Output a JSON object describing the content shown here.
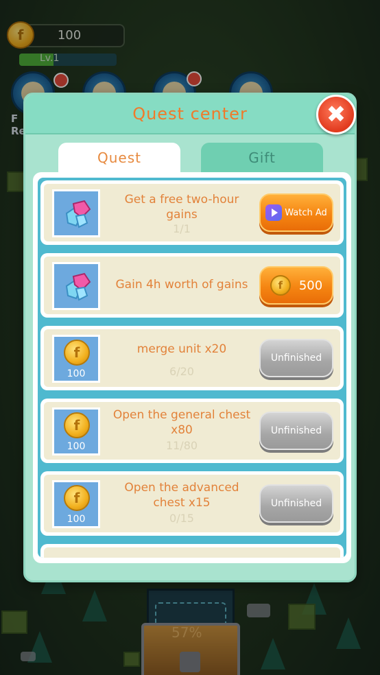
{
  "hud": {
    "coins": "100",
    "coin_symbol": "f",
    "level": "Lv.1",
    "level_progress": 0.35,
    "side_label_1": "F",
    "side_label_2": "Re"
  },
  "modal": {
    "title": "Quest center",
    "close_label": "✖",
    "tabs": [
      {
        "label": "Quest",
        "active": true
      },
      {
        "label": "Gift",
        "active": false
      }
    ]
  },
  "quests": [
    {
      "title": "Get a free two-hour gains",
      "progress": "1/1",
      "reward_icon": "gem-icon",
      "reward_amount": "",
      "button": {
        "type": "ad",
        "label": "Watch Ad"
      }
    },
    {
      "title": "Gain 4h worth of gains",
      "progress": "",
      "reward_icon": "gem-icon",
      "reward_amount": "",
      "button": {
        "type": "buy",
        "label": "500"
      }
    },
    {
      "title": "merge unit x20",
      "progress": "6/20",
      "reward_icon": "coin-icon",
      "reward_amount": "100",
      "button": {
        "type": "unfinished",
        "label": "Unfinished"
      }
    },
    {
      "title": "Open the general chest x80",
      "progress": "11/80",
      "reward_icon": "coin-icon",
      "reward_amount": "100",
      "button": {
        "type": "unfinished",
        "label": "Unfinished"
      }
    },
    {
      "title": "Open the advanced chest x15",
      "progress": "0/15",
      "reward_icon": "coin-icon",
      "reward_amount": "100",
      "button": {
        "type": "unfinished",
        "label": "Unfinished"
      }
    }
  ],
  "chest": {
    "progress_text": "57%"
  },
  "colors": {
    "title_orange": "#f07a2a",
    "modal_bg": "#a9e3cf",
    "list_blue": "#4fb9cf",
    "card_cream": "#f0ebd3",
    "button_orange": "#f58512",
    "button_gray": "#a6a6a6"
  }
}
